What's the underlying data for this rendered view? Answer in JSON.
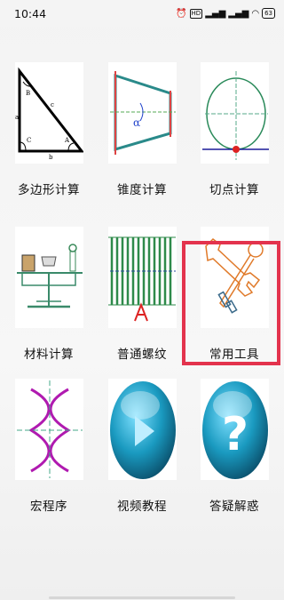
{
  "status_bar": {
    "time": "10:44",
    "icons": [
      "alarm-icon",
      "hd-badge",
      "signal-icon",
      "signal-icon",
      "wifi-icon",
      "battery-icon"
    ],
    "hd_text": "HD",
    "battery_level": "63"
  },
  "tools": [
    {
      "id": "polygon",
      "label": "多边形计算",
      "icon": "triangle-diagram"
    },
    {
      "id": "taper",
      "label": "锥度计算",
      "icon": "taper-diagram"
    },
    {
      "id": "tangent",
      "label": "切点计算",
      "icon": "tangent-circle-diagram"
    },
    {
      "id": "material",
      "label": "材料计算",
      "icon": "balance-scale-diagram"
    },
    {
      "id": "thread",
      "label": "普通螺纹",
      "icon": "screw-thread-diagram"
    },
    {
      "id": "common-tools",
      "label": "常用工具",
      "icon": "wrench-icon",
      "highlighted": true
    },
    {
      "id": "macro",
      "label": "宏程序",
      "icon": "macro-curve-diagram"
    },
    {
      "id": "video",
      "label": "视频教程",
      "icon": "play-video-icon"
    },
    {
      "id": "faq",
      "label": "答疑解惑",
      "icon": "question-mark-icon"
    }
  ],
  "colors": {
    "highlight_border": "#e3334d",
    "background": "#f3f3f3"
  }
}
